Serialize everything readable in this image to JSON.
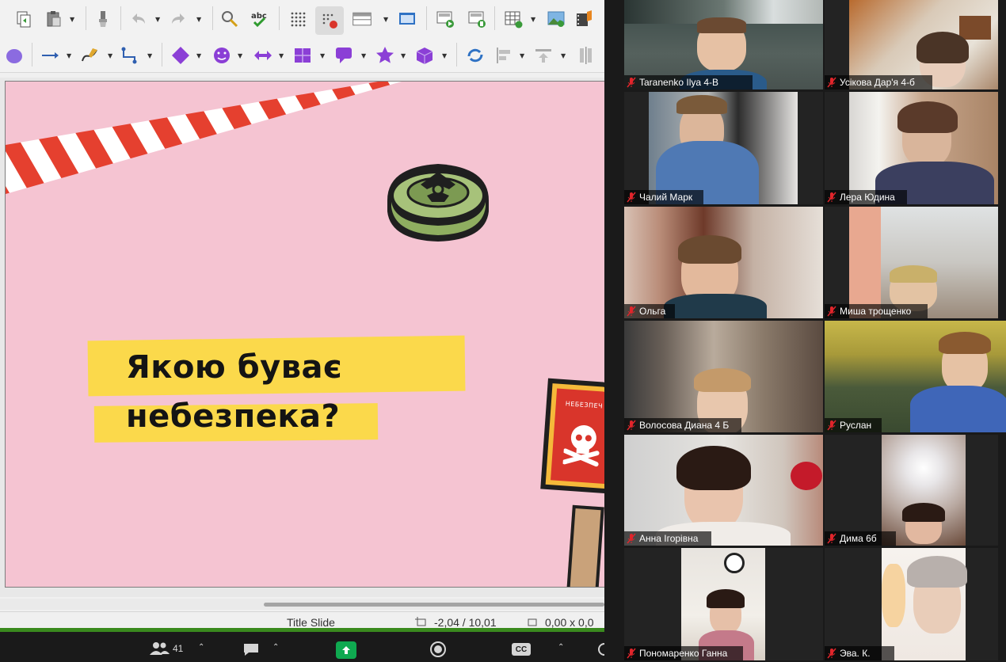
{
  "app": {
    "status": {
      "layout": "Title Slide",
      "position": "-2,04 / 10,01",
      "size": "0,00 x 0,0"
    }
  },
  "slide": {
    "title_line1": "Якою буває",
    "title_line2": "небезпека?",
    "sign_text": "НЕБЕЗПЕЧ"
  },
  "colors": {
    "slide_bg": "#f5c4d2",
    "highlight": "#fbd94b",
    "tape_red": "#e5402f",
    "mine_green": "#a7c27a",
    "sign_red": "#d9352b",
    "status_green": "#3a8a1e"
  },
  "zoom_toolbar": {
    "participants_count": "41",
    "cc_label": "CC"
  },
  "participants": [
    {
      "name": "Taranenko Ilya 4-В",
      "muted": true
    },
    {
      "name": "Усікова Дар'я 4-б",
      "muted": true
    },
    {
      "name": "Чалий Марк",
      "muted": true
    },
    {
      "name": "Лера Юдина",
      "muted": true
    },
    {
      "name": "Ольга",
      "muted": true
    },
    {
      "name": "Миша трощенко",
      "muted": true
    },
    {
      "name": "Волосова Диана 4 Б",
      "muted": true
    },
    {
      "name": "Руслан",
      "muted": true
    },
    {
      "name": "Анна Ігорівна",
      "muted": true
    },
    {
      "name": "Дима 6б",
      "muted": true
    },
    {
      "name": "Пономаренко Ганна",
      "muted": true
    },
    {
      "name": "Эва. К.",
      "muted": true
    }
  ],
  "icons": [
    "clone-icon",
    "paste-icon",
    "clone-formatting-icon",
    "undo-icon",
    "redo-icon",
    "find-replace-icon",
    "spelling-icon",
    "grid-icon",
    "snap-icon",
    "table-layout-icon",
    "display-views-icon",
    "slide-start-icon",
    "slide-current-icon",
    "insert-table-icon",
    "insert-image-icon",
    "insert-media-icon",
    "ellipse-icon",
    "line-arrow-icon",
    "curve-icon",
    "connector-icon",
    "basic-shapes-icon",
    "symbol-shapes-icon",
    "block-arrows-icon",
    "flowchart-icon",
    "callout-icon",
    "stars-icon",
    "3d-objects-icon",
    "rotate-icon",
    "align-icon",
    "arrange-icon",
    "distribute-icon",
    "participants-icon",
    "chat-icon",
    "share-screen-icon",
    "record-icon",
    "captions-icon",
    "more-icon",
    "mic-muted-icon"
  ]
}
